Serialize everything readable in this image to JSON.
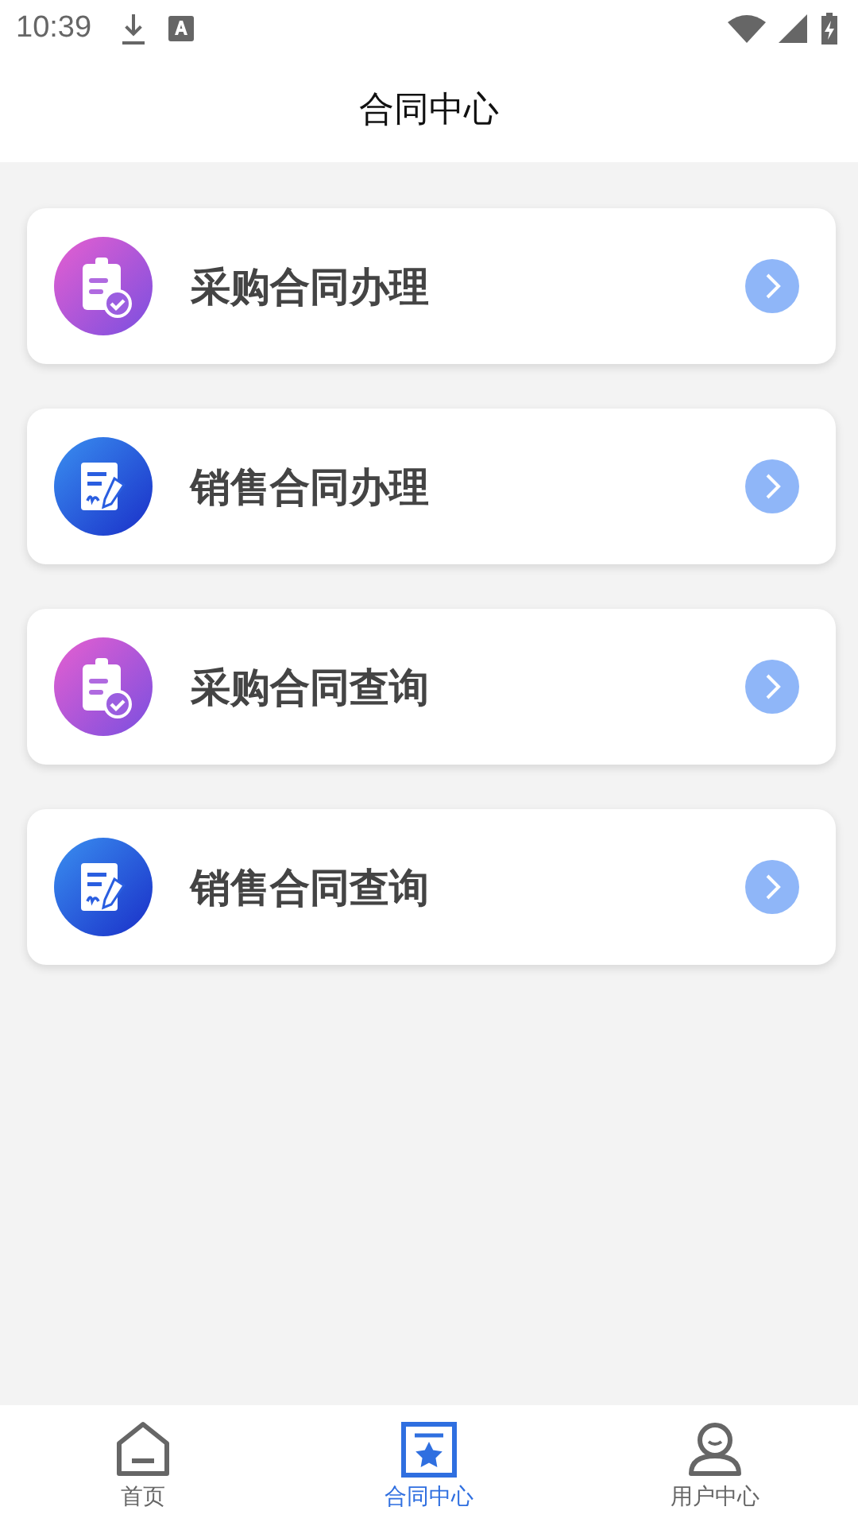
{
  "status_bar": {
    "time": "10:39"
  },
  "header": {
    "title": "合同中心"
  },
  "items": [
    {
      "label": "采购合同办理",
      "kind": "purchase"
    },
    {
      "label": "销售合同办理",
      "kind": "sales"
    },
    {
      "label": "采购合同查询",
      "kind": "purchase"
    },
    {
      "label": "销售合同查询",
      "kind": "sales"
    }
  ],
  "tabs": [
    {
      "label": "首页",
      "kind": "home",
      "selected": false
    },
    {
      "label": "合同中心",
      "kind": "contract",
      "selected": true
    },
    {
      "label": "用户中心",
      "kind": "user",
      "selected": false
    }
  ]
}
